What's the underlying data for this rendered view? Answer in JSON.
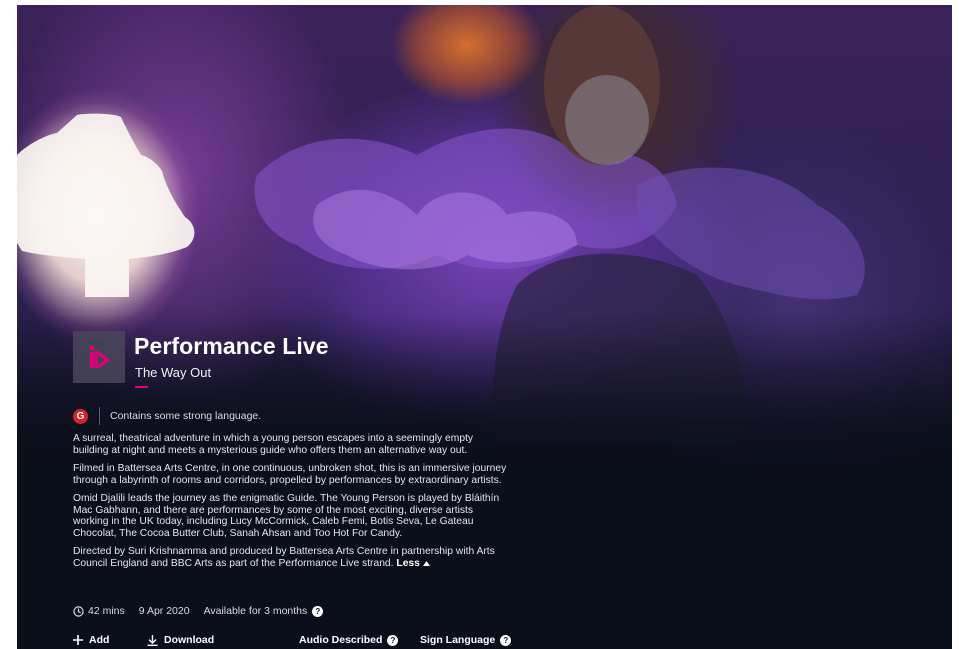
{
  "programme": {
    "brand": "Performance Live",
    "episode": "The Way Out",
    "guidance_badge": "G",
    "guidance_text": "Contains some strong language.",
    "description": [
      "A surreal, theatrical adventure in which a young person escapes into a seemingly empty building at night and meets a mysterious guide who offers them an alternative way out.",
      "Filmed in Battersea Arts Centre, in one continuous, unbroken shot, this is an immersive journey through a labyrinth of rooms and corridors, propelled by performances by extraordinary artists.",
      "Omid Djalili leads the journey as the enigmatic Guide. The Young Person is played by Bláithín Mac Gabhann, and there are performances by some of the most exciting, diverse artists working in the UK today, including Lucy McCormick, Caleb Femi, Botis Seva, Le Gateau Chocolat, The Cocoa Butter Club, Sanah Ahsan and Too Hot For Candy.",
      "Directed by Suri Krishnamma and produced by Battersea Arts Centre in partnership with Arts Council England and BBC Arts as part of the Performance Live strand."
    ],
    "less_label": "Less",
    "duration": "42 mins",
    "first_shown": "9 Apr 2020",
    "availability": "Available for 3 months"
  },
  "actions": {
    "add": "Add",
    "download": "Download",
    "audio_described": "Audio Described",
    "sign_language": "Sign Language"
  },
  "icons": {
    "brand": "iplayer-play-icon",
    "duration": "clock-icon",
    "help": "question-icon",
    "add": "plus-icon",
    "download": "download-icon",
    "less": "chevron-up-icon"
  },
  "colors": {
    "accent_pink": "#e2007a",
    "guidance_red": "#d7222a",
    "background": "#0b0f1a"
  }
}
